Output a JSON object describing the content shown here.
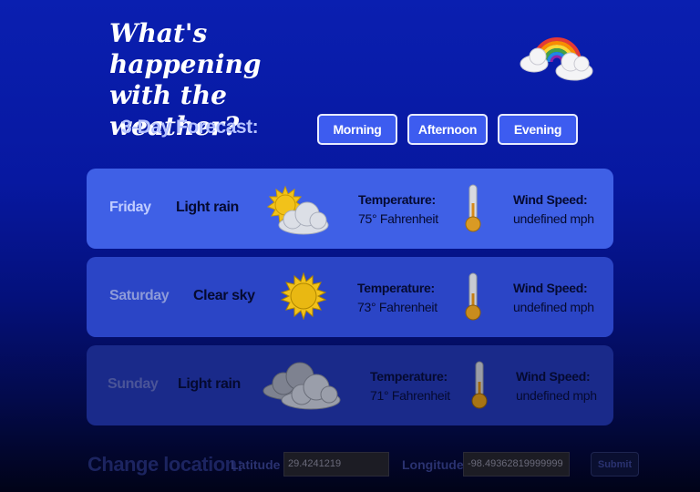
{
  "header": {
    "title_line1": "What's happening",
    "title_line2": "with the weather?",
    "logo_icon": "rainbow-cloud-icon"
  },
  "forecast": {
    "label": "3-Day Forecast:",
    "tabs": [
      {
        "label": "Morning"
      },
      {
        "label": "Afternoon"
      },
      {
        "label": "Evening"
      }
    ],
    "days": [
      {
        "day": "Friday",
        "condition": "Light rain",
        "icon": "sun-cloud-icon",
        "temp_label": "Temperature:",
        "temp_value": "75° Fahrenheit",
        "wind_label": "Wind Speed:",
        "wind_value": "undefined mph"
      },
      {
        "day": "Saturday",
        "condition": "Clear sky",
        "icon": "sun-icon",
        "temp_label": "Temperature:",
        "temp_value": "73° Fahrenheit",
        "wind_label": "Wind Speed:",
        "wind_value": "undefined mph"
      },
      {
        "day": "Sunday",
        "condition": "Light rain",
        "icon": "cloud-icon",
        "temp_label": "Temperature:",
        "temp_value": "71° Fahrenheit",
        "wind_label": "Wind Speed:",
        "wind_value": "undefined mph"
      }
    ]
  },
  "location": {
    "label": "Change location:",
    "latitude_label": "Latitude",
    "latitude_value": "29.4241219",
    "longitude_label": "Longitude",
    "longitude_value": "-98.49362819999999",
    "submit_label": "Submit"
  },
  "colors": {
    "tab_bg": "#3d5cf0",
    "card_friday": "#3f60e6",
    "card_saturday": "#2b45c6",
    "card_sunday": "#1a2a8a"
  }
}
